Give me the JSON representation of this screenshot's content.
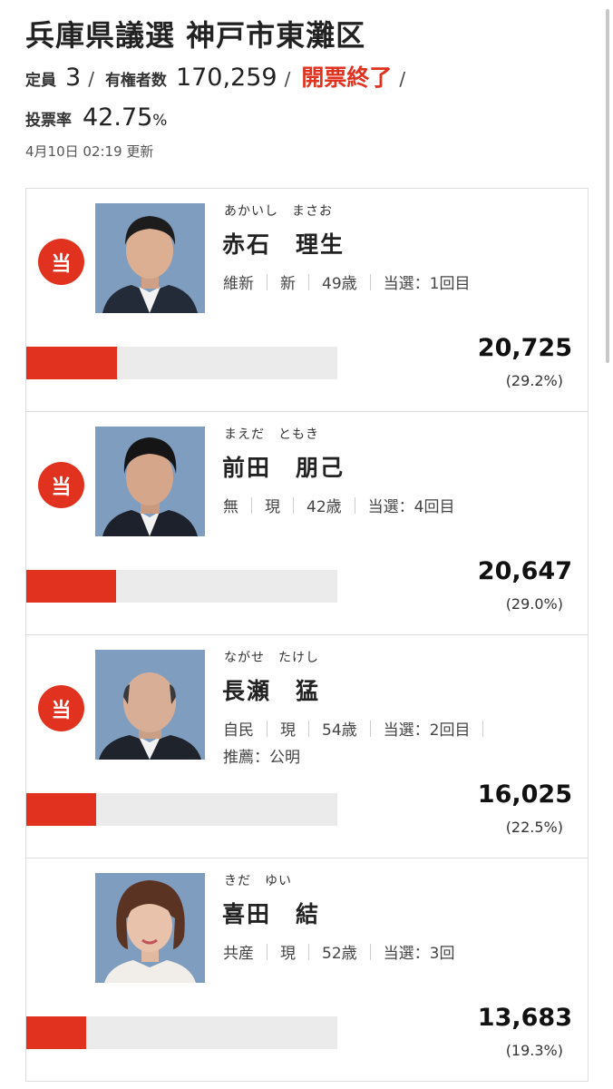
{
  "header": {
    "title": "兵庫県議選 神戸市東灘区",
    "seats_label": "定員",
    "seats": "3",
    "voters_label": "有権者数",
    "voters": "170,259",
    "status": "開票終了",
    "turnout_label": "投票率",
    "turnout": "42.75",
    "turnout_unit": "%",
    "updated": "4月10日 02:19 更新",
    "separator": "/"
  },
  "colors": {
    "accent": "#e0321f",
    "bar_bg": "#ebebeb",
    "photo_bg": "#7f9dbf"
  },
  "candidates": [
    {
      "elected": true,
      "badge": "当",
      "kana": "あかいし　まさお",
      "name": "赤石　理生",
      "party": "維新",
      "status": "新",
      "age": "49歳",
      "wins": "当選：1回目",
      "extra": "",
      "votes": "20,725",
      "share": "(29.2%)",
      "share_value": 29.2
    },
    {
      "elected": true,
      "badge": "当",
      "kana": "まえだ　ともき",
      "name": "前田　朋己",
      "party": "無",
      "status": "現",
      "age": "42歳",
      "wins": "当選：4回目",
      "extra": "",
      "votes": "20,647",
      "share": "(29.0%)",
      "share_value": 29.0
    },
    {
      "elected": true,
      "badge": "当",
      "kana": "ながせ　たけし",
      "name": "長瀬　猛",
      "party": "自民",
      "status": "現",
      "age": "54歳",
      "wins": "当選：2回目",
      "extra": "推薦：公明",
      "votes": "16,025",
      "share": "(22.5%)",
      "share_value": 22.5
    },
    {
      "elected": false,
      "badge": "",
      "kana": "きだ　ゆい",
      "name": "喜田　結",
      "party": "共産",
      "status": "現",
      "age": "52歳",
      "wins": "当選：3回",
      "extra": "",
      "votes": "13,683",
      "share": "(19.3%)",
      "share_value": 19.3
    }
  ]
}
